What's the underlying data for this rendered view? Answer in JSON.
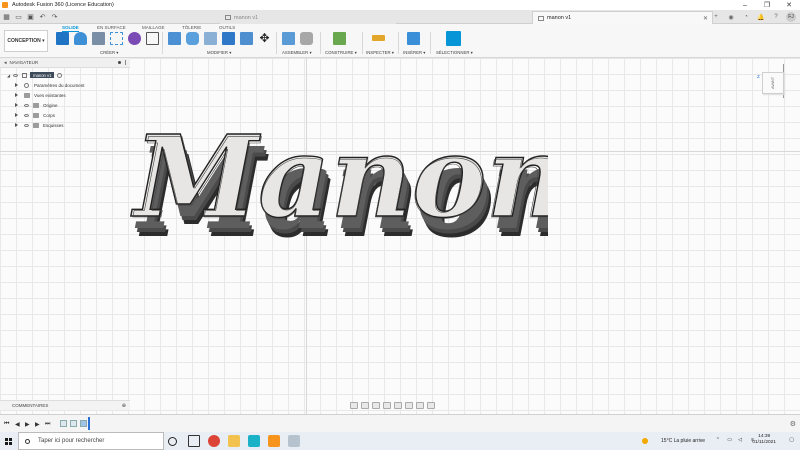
{
  "window": {
    "title": "Autodesk Fusion 360 (Licence Education)"
  },
  "tabs": [
    {
      "label": "manon v1",
      "active": false
    },
    {
      "label": "manon v1",
      "active": true
    }
  ],
  "user_initials": "FJ",
  "workspace": {
    "label": "CONCEPTION ▾"
  },
  "ribbon_tabs": [
    "SOLIDE",
    "EN SURFACE",
    "MAILLAGE",
    "TÔLERIE",
    "OUTILS"
  ],
  "groups": {
    "create": "CRÉER ▾",
    "modify": "MODIFIER ▾",
    "assemble": "ASSEMBLER ▾",
    "construct": "CONSTRUIRE ▾",
    "inspect": "INSPECTER ▾",
    "insert": "INSÉRER ▾",
    "select": "SÉLECTIONNER ▾"
  },
  "browser": {
    "title": "NAVIGATEUR",
    "root": "manon v1",
    "items": [
      "Paramètres du document",
      "Vues existantes",
      "Origine",
      "Corps",
      "Esquisses"
    ]
  },
  "viewcube": {
    "face": "AVANT"
  },
  "model": {
    "text": "Manon"
  },
  "comments": {
    "label": "COMMENTAIRES"
  },
  "taskbar": {
    "search_placeholder": "Taper ici pour rechercher",
    "weather": "15°C  La pluie arrive",
    "time": "14:39",
    "date": "01/11/2021"
  },
  "colors": {
    "accent": "#0696d7",
    "model_face": "#e7e6e4",
    "model_side": "#3c3c3c"
  }
}
